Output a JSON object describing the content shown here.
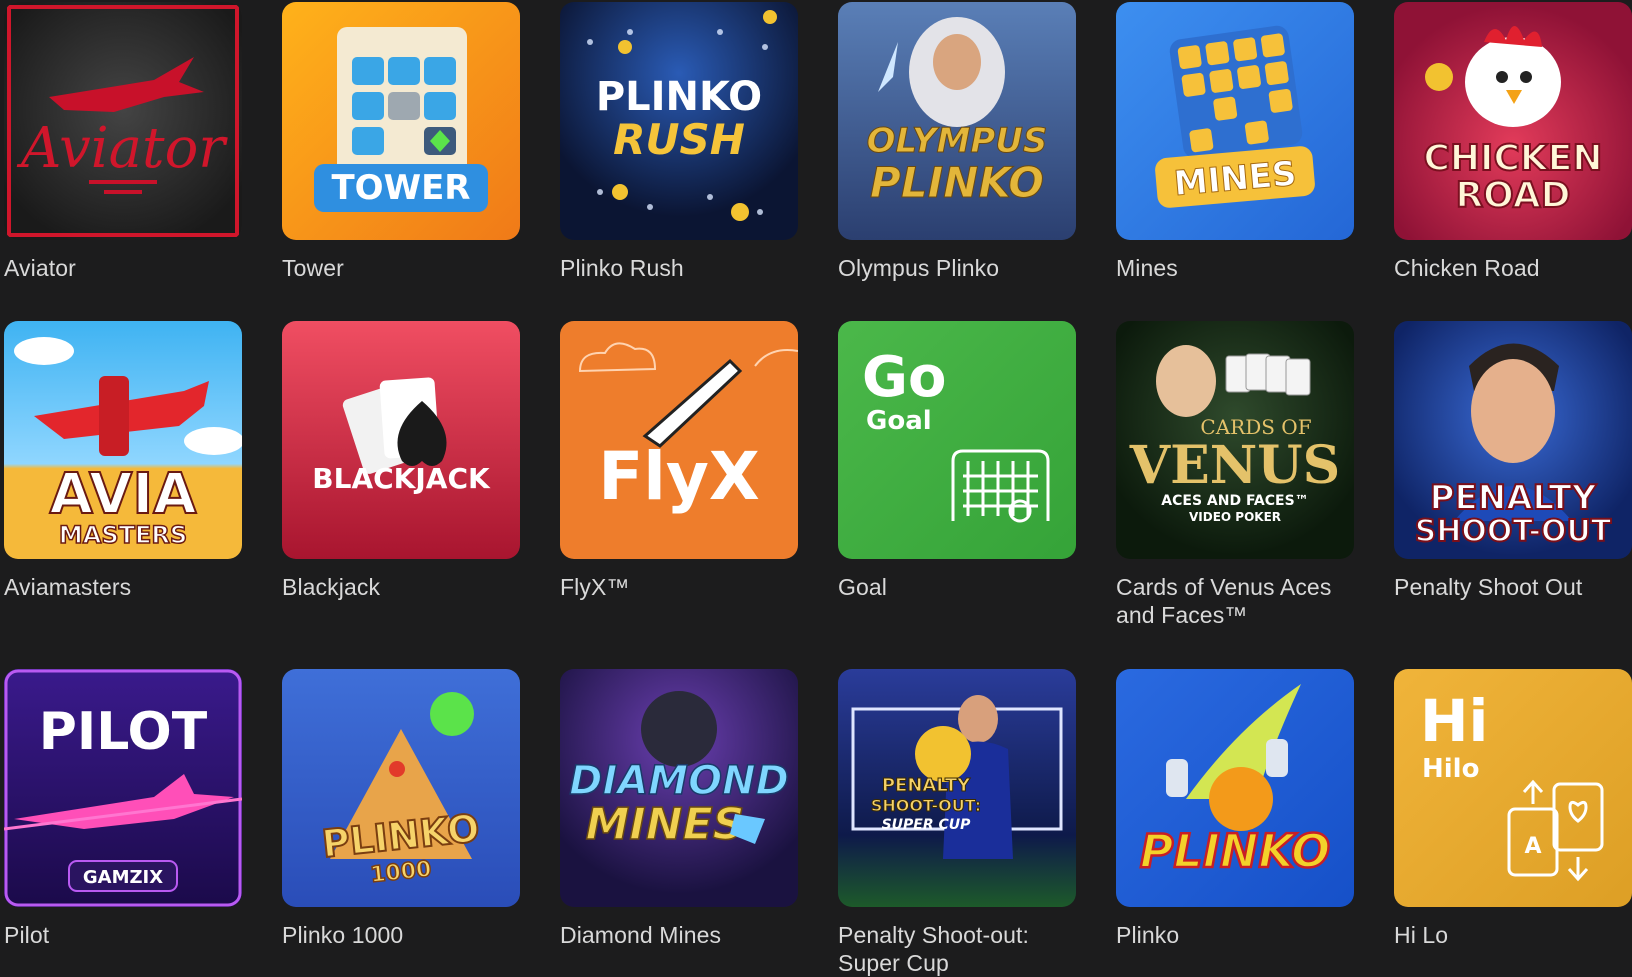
{
  "games": [
    {
      "title": "Aviator",
      "art": "AVIATOR-LOGO",
      "art_text": "Aviator"
    },
    {
      "title": "Tower",
      "art": "TOWER-LOGO",
      "art_text": "TOWER"
    },
    {
      "title": "Plinko Rush",
      "art": "PLINKO-RUSH-LOGO",
      "art_text_1": "PLINKO",
      "art_text_2": "RUSH"
    },
    {
      "title": "Olympus Plinko",
      "art": "OLYMPUS-PLINKO-LOGO",
      "art_text_1": "OLYMPUS",
      "art_text_2": "PLINKO"
    },
    {
      "title": "Mines",
      "art": "MINES-LOGO",
      "art_text": "MINES"
    },
    {
      "title": "Chicken Road",
      "art": "CHICKEN-ROAD-LOGO",
      "art_text_1": "CHICKEN",
      "art_text_2": "ROAD"
    },
    {
      "title": "Aviamasters",
      "art": "AVIAMASTERS-LOGO",
      "art_text_1": "AVIA",
      "art_text_2": "MASTERS"
    },
    {
      "title": "Blackjack",
      "art": "BLACKJACK-LOGO",
      "art_text": "BLACKJACK"
    },
    {
      "title": "FlyX™",
      "art": "FLYX-LOGO",
      "art_text": "FlyX"
    },
    {
      "title": "Goal",
      "art": "GOAL-LOGO",
      "art_text_1": "Go",
      "art_text_2": "Goal"
    },
    {
      "title": "Cards of Venus Aces and Faces™",
      "art": "VENUS-LOGO",
      "art_text_1": "CARDS OF",
      "art_text_2": "VENUS",
      "art_text_3": "ACES AND FACES™",
      "art_text_4": "VIDEO POKER"
    },
    {
      "title": "Penalty Shoot Out",
      "art": "PENALTY-LOGO",
      "art_text_1": "PENALTY",
      "art_text_2": "SHOOT-OUT"
    },
    {
      "title": "Pilot",
      "art": "PILOT-LOGO",
      "art_text_1": "PILOT",
      "art_text_2": "GAMZIX"
    },
    {
      "title": "Plinko 1000",
      "art": "PLINKO1000-LOGO",
      "art_text_1": "PLINKO",
      "art_text_2": "1000"
    },
    {
      "title": "Diamond Mines",
      "art": "DIAMOND-MINES-LOGO",
      "art_text_1": "DIAMOND",
      "art_text_2": "MINES"
    },
    {
      "title": "Penalty Shoot-out: Super Cup",
      "art": "PENALTY-SUPERCUP-LOGO",
      "art_text_1": "PENALTY",
      "art_text_2": "SHOOT-OUT:",
      "art_text_3": "SUPER CUP"
    },
    {
      "title": "Plinko",
      "art": "PLINKO-LOGO",
      "art_text": "PLINKO"
    },
    {
      "title": "Hi Lo",
      "art": "HILO-LOGO",
      "art_text_1": "Hi",
      "art_text_2": "Hilo"
    }
  ]
}
